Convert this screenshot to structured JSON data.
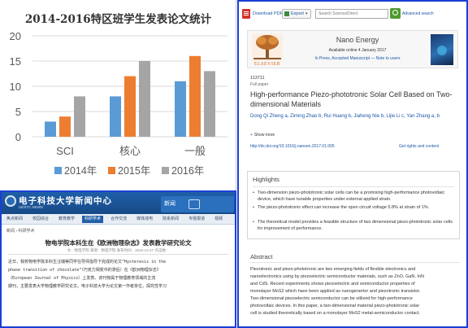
{
  "chart": {
    "title": "2014-2016特区班学生发表论文统计"
  },
  "chart_data": {
    "type": "bar",
    "title": "2014-2016特区班学生发表论文统计",
    "categories": [
      "SCI",
      "核心",
      "一般"
    ],
    "series": [
      {
        "name": "2014年",
        "values": [
          3,
          8,
          11
        ],
        "color": "#5b9bd5"
      },
      {
        "name": "2015年",
        "values": [
          4,
          12,
          16
        ],
        "color": "#ed7d31"
      },
      {
        "name": "2016年",
        "values": [
          8,
          15,
          13
        ],
        "color": "#a5a5a5"
      }
    ],
    "ylim": [
      0,
      20
    ],
    "yticks": [
      0,
      5,
      10,
      15,
      20
    ],
    "grid": true,
    "legend_position": "bottom",
    "xlabel": "",
    "ylabel": ""
  },
  "news": {
    "logo": "电子科技大学新闻中心",
    "logo_sub": "UESTC NEWS",
    "header_right": "新闻",
    "nav": [
      "焦点新闻",
      "校园综合",
      "教育教学",
      "科研学术",
      "合作交流",
      "媒体成电",
      "院系新闻",
      "专题报道",
      "视频"
    ],
    "nav_active_index": 3,
    "breadcrumb": "新闻 › 科研学术",
    "title": "物电学院本科生在《欧洲物理杂志》发表教学研究论文",
    "meta": "文：物电学院  来源：物电学院  发布时间：2016-12-27  点击数：",
    "body": [
      "    近日，我校物电学院本科生汪瑞等同学在导师指导下完成的论文“Hysteresis in the",
      "phase transition of chocolate”（巧克力相变中的滞后）在《欧洲物理杂志》",
      "（European Journal of Physics）上发表。该刊物属于物理教育领域的主流",
      "期刊，主要发表大学物理教学研究论文。电子科技大学为论文第一作者单位，探究性学习"
    ]
  },
  "paper": {
    "download_pdf": "Download PDF",
    "export": "Export",
    "search_placeholder": "Search ScienceDirect",
    "advanced_search": "Advanced search",
    "journal_name": "Nano Energy",
    "available_online": "Available online 4 January 2017",
    "journal_links": "In Press, Accepted Manuscript — Note to users",
    "publisher_logo": "ELSEVIER",
    "article_number": "113711",
    "article_type": "Full paper",
    "title": "High-performance Piezo-phototronic Solar Cell Based on Two-dimensional Materials",
    "authors": "Dong Qi Zheng a, Ziming Zhao b, Rui Huang b, Jiaheng Nie b, Lijie Li c, Yan Zhang a, b",
    "show_more": "Show more",
    "doi": "http://dx.doi.org/10.1016/j.nanoen.2017.01.005",
    "rights": "Get rights and content",
    "highlights_heading": "Highlights",
    "highlights": [
      "Two-dimension piezo-phototronic solar cells can be a promising high-performance photovoltaic device, which have tunable properties under external applied strain.",
      "The piezo-phototronic effect can increase the open circuit voltage 5.8% at strain of 1%.",
      "The theoretical model provides a feasible structure of two dimensional piezo-phototronic solar cells for improvement of performance."
    ],
    "abstract_heading": "Abstract",
    "abstract_lines": [
      "Piezotronic and piezo-phototronic are two emerging fields of flexible electronics and",
      "nanoelectronics using by piezoelectric semiconductor materials, such as ZnO, GaN, InN",
      "and CdS. Recent experiments shows piezoelectric and semiconductor properties of",
      "monolayer MoS2 which have been applied as nanogenertor and piezotronic transistor.",
      "Two-dimensional piezoelectric semiconductor can be utilized for high-performance",
      "photovoltaic devices. In this paper, a two-dimensional material piezo-phototronic solar",
      "cell is studied theoretically based on a monolayer MoS2 metal-semiconductor contact."
    ]
  }
}
